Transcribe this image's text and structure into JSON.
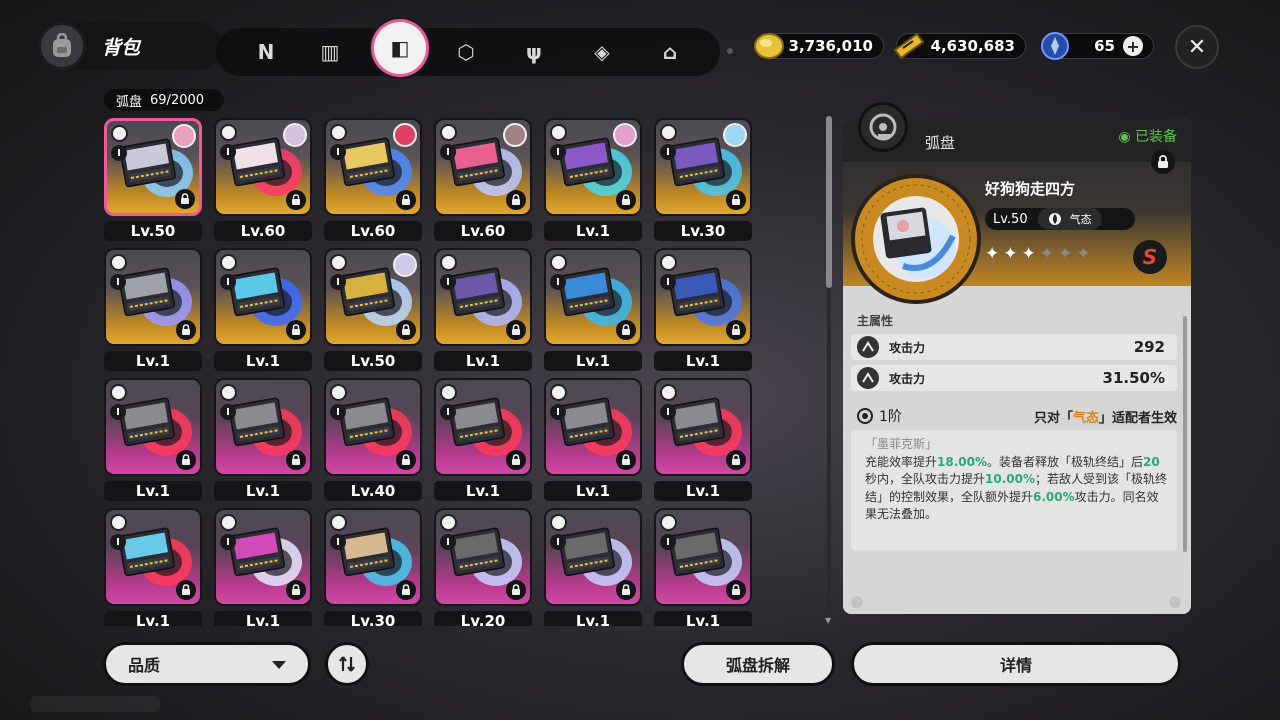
{
  "header": {
    "bag_title": "背包",
    "tabs": [
      {
        "name": "tab-agents",
        "icon": "N"
      },
      {
        "name": "tab-bangboo",
        "icon": "▥"
      },
      {
        "name": "tab-drive-discs",
        "icon": "◧"
      },
      {
        "name": "tab-materials",
        "icon": "⬡"
      },
      {
        "name": "tab-food",
        "icon": "ψ"
      },
      {
        "name": "tab-props",
        "icon": "◈"
      },
      {
        "name": "tab-furniture",
        "icon": "⌂"
      }
    ],
    "currencies": [
      {
        "name": "dennies",
        "value": "3,736,010",
        "color": "#e8c23a"
      },
      {
        "name": "polychrome",
        "value": "4,630,683",
        "color": "#e8b82a"
      },
      {
        "name": "battery",
        "value": "65",
        "color": "#4a7ae8"
      }
    ]
  },
  "inventory": {
    "label": "弧盘",
    "count": "69/2000",
    "cards": [
      {
        "lv": "Lv.50",
        "rarity": "gold",
        "avatar": true,
        "avatar_color": "#e8a0c0",
        "art_color": "#c8c8d8",
        "glow": "#88ccff",
        "selected": true
      },
      {
        "lv": "Lv.60",
        "rarity": "gold",
        "avatar": true,
        "avatar_color": "#d8c0e0",
        "art_color": "#f0e0e8",
        "glow": "#ff3a6a"
      },
      {
        "lv": "Lv.60",
        "rarity": "gold",
        "avatar": true,
        "avatar_color": "#e04060",
        "art_color": "#e8c860",
        "glow": "#4a8aff"
      },
      {
        "lv": "Lv.60",
        "rarity": "gold",
        "avatar": true,
        "avatar_color": "#a08080",
        "art_color": "#e86090",
        "glow": "#c0c8ff"
      },
      {
        "lv": "Lv.1",
        "rarity": "gold",
        "avatar": true,
        "avatar_color": "#e0a0d0",
        "art_color": "#8a5ac8",
        "glow": "#4ad8e8"
      },
      {
        "lv": "Lv.30",
        "rarity": "gold",
        "avatar": true,
        "avatar_color": "#a0d8f0",
        "art_color": "#7a5ac0",
        "glow": "#48c8f0"
      },
      {
        "lv": "Lv.1",
        "rarity": "gold",
        "avatar": false,
        "art_color": "#a0a0a8",
        "glow": "#9a9aff"
      },
      {
        "lv": "Lv.1",
        "rarity": "gold",
        "avatar": false,
        "art_color": "#5ac8e8",
        "glow": "#3a6aff"
      },
      {
        "lv": "Lv.50",
        "rarity": "gold",
        "avatar": true,
        "avatar_color": "#d0c8e8",
        "art_color": "#d8b040",
        "glow": "#b8d8ff"
      },
      {
        "lv": "Lv.1",
        "rarity": "gold",
        "avatar": false,
        "art_color": "#6a5aa8",
        "glow": "#b0b8ff"
      },
      {
        "lv": "Lv.1",
        "rarity": "gold",
        "avatar": false,
        "art_color": "#3a8ad8",
        "glow": "#3ab8f0"
      },
      {
        "lv": "Lv.1",
        "rarity": "gold",
        "avatar": false,
        "art_color": "#3a5ab8",
        "glow": "#4a78e8"
      },
      {
        "lv": "Lv.1",
        "rarity": "purple",
        "avatar": false,
        "art_color": "#8a8a90",
        "glow": "#ff3a5a"
      },
      {
        "lv": "Lv.1",
        "rarity": "purple",
        "avatar": false,
        "art_color": "#8a8a90",
        "glow": "#ff3a5a"
      },
      {
        "lv": "Lv.40",
        "rarity": "purple",
        "avatar": false,
        "art_color": "#8a8a90",
        "glow": "#ff3a5a"
      },
      {
        "lv": "Lv.1",
        "rarity": "purple",
        "avatar": false,
        "art_color": "#8a8a90",
        "glow": "#ff3a5a"
      },
      {
        "lv": "Lv.1",
        "rarity": "purple",
        "avatar": false,
        "art_color": "#8a8a90",
        "glow": "#ff3a5a"
      },
      {
        "lv": "Lv.1",
        "rarity": "purple",
        "avatar": false,
        "art_color": "#8a8a90",
        "glow": "#ff3a5a"
      },
      {
        "lv": "Lv.1",
        "rarity": "purple",
        "avatar": false,
        "art_color": "#6ac8e8",
        "glow": "#ff3a5a"
      },
      {
        "lv": "Lv.1",
        "rarity": "purple",
        "avatar": false,
        "art_color": "#d04ab8",
        "glow": "#e8e8ff"
      },
      {
        "lv": "Lv.30",
        "rarity": "purple",
        "avatar": false,
        "art_color": "#d8b890",
        "glow": "#48c8f0"
      },
      {
        "lv": "Lv.20",
        "rarity": "purple",
        "avatar": false,
        "art_color": "#6a6a6a",
        "glow": "#c8d0ff"
      },
      {
        "lv": "Lv.1",
        "rarity": "purple",
        "avatar": false,
        "art_color": "#6a6a6a",
        "glow": "#c8d0ff"
      },
      {
        "lv": "Lv.1",
        "rarity": "purple",
        "avatar": false,
        "art_color": "#6a6a6a",
        "glow": "#c8d0ff"
      }
    ]
  },
  "detail": {
    "title": "弧盘",
    "equipped": "◉ 已装备",
    "name": "好狗狗走四方",
    "level": "Lv.50",
    "attribute": "气态",
    "stars_filled": 3,
    "stars_total": 6,
    "rank": "S",
    "main_stats_label": "主属性",
    "stats": [
      {
        "name": "攻击力",
        "value": "292"
      },
      {
        "name": "攻击力",
        "value": "31.50%"
      }
    ],
    "tier": "1阶",
    "condition_pre": "只对「",
    "condition_attr": "气态",
    "condition_post": "」适配者生效",
    "effect_name": "「墨菲克斯」",
    "effect_parts": [
      {
        "t": "充能效率提升",
        "c": ""
      },
      {
        "t": "18.00%",
        "c": "g"
      },
      {
        "t": "。",
        "c": ""
      },
      {
        "t": "装备者释放「极轨终结」后",
        "c": ""
      },
      {
        "t": "20",
        "c": "g"
      },
      {
        "t": "秒内，全队攻击力提升",
        "c": ""
      },
      {
        "t": "10.00%",
        "c": "g"
      },
      {
        "t": "；若敌人受到该「极轨终结」的控制效果，全队额外提升",
        "c": ""
      },
      {
        "t": "6.00%",
        "c": "g"
      },
      {
        "t": "攻击力。同名效果无法叠加。",
        "c": ""
      }
    ]
  },
  "footer": {
    "filter_label": "品质",
    "dismantle_label": "弧盘拆解",
    "details_label": "详情"
  }
}
